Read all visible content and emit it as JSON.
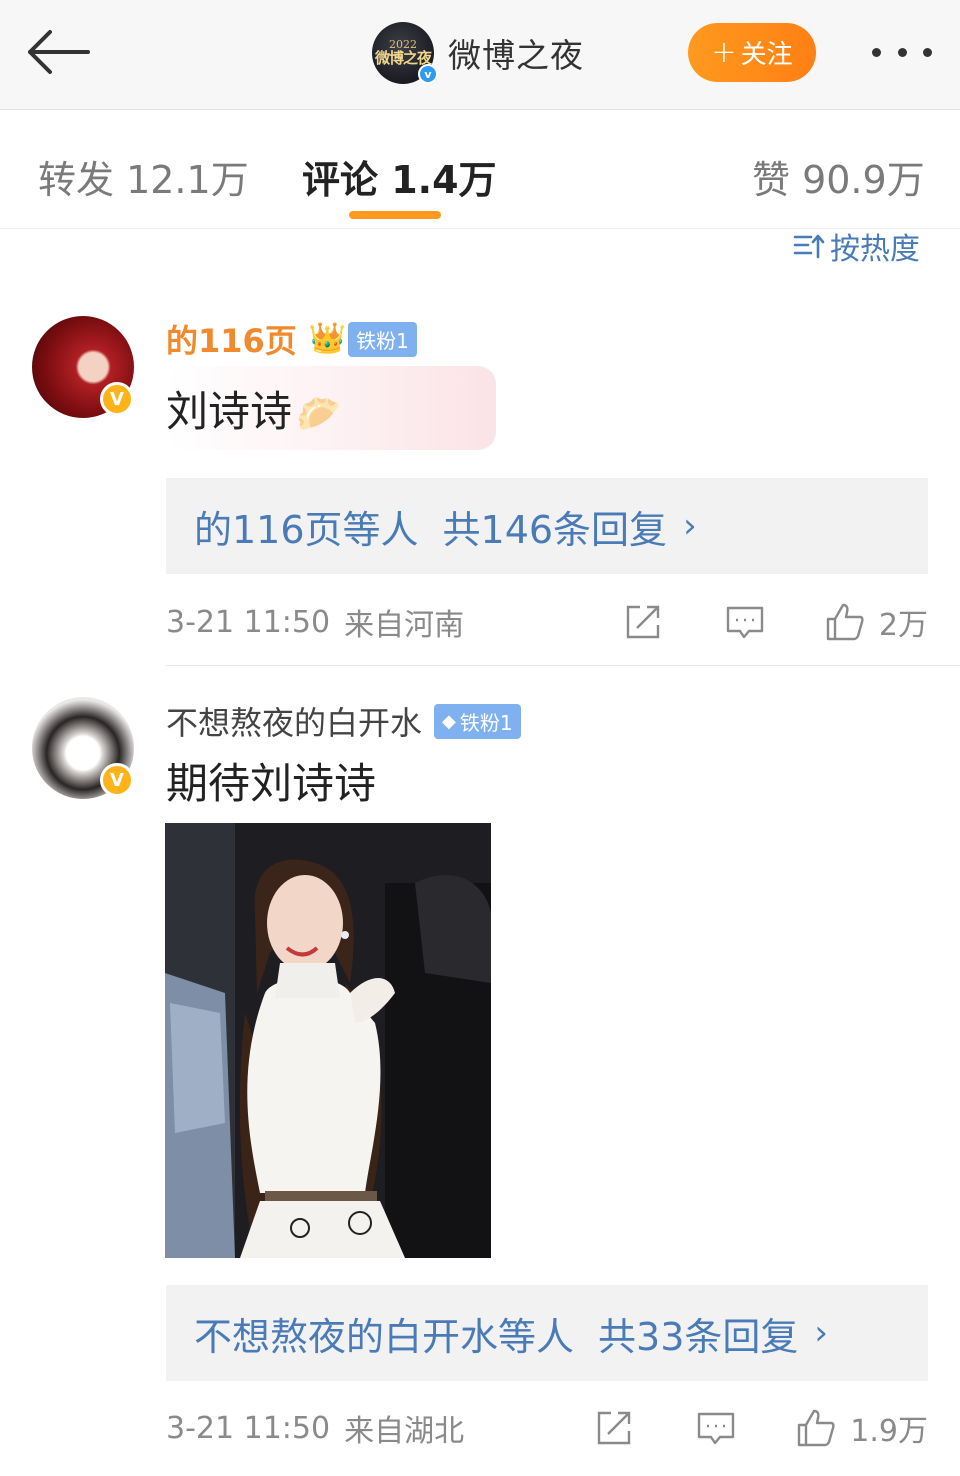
{
  "nav": {
    "title": "微博之夜",
    "avatar_year": "2022",
    "avatar_logo": "微博之夜",
    "follow_label": "关注",
    "icons": {
      "back": "back-arrow-icon",
      "more": "more-dots-icon",
      "verified": "verified-icon"
    }
  },
  "tabs": {
    "repost": "转发 12.1万",
    "comment": "评论 1.4万",
    "like": "赞 90.9万",
    "active": "comment",
    "accent": "#ff9a1e"
  },
  "sort": {
    "label": "按热度"
  },
  "comments": [
    {
      "username": "的116页",
      "fan_badge": "铁粉1",
      "text": "刘诗诗",
      "emoji": "🥟",
      "reply_summary": {
        "who": "的116页等人",
        "count": "共146条回复"
      },
      "time": "3-21 11:50",
      "location": "来自河南",
      "likes": "2万"
    },
    {
      "username": "不想熬夜的白开水",
      "fan_badge": "铁粉1",
      "text": "期待刘诗诗",
      "reply_summary": {
        "who": "不想熬夜的白开水等人",
        "count": "共33条回复"
      },
      "time": "3-21 11:50",
      "location": "来自湖北",
      "likes": "1.9万"
    }
  ],
  "colors": {
    "link_blue": "#4a7bb7",
    "name_orange": "#f08a2d",
    "badge_blue": "#7fb1f0",
    "verified_gold": "#ffb31a"
  }
}
